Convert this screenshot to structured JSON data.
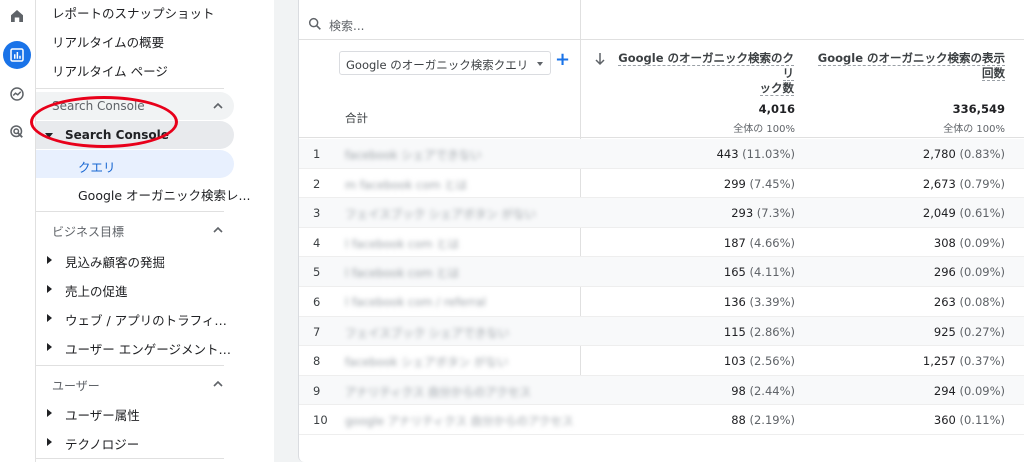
{
  "nav": {
    "items_top": [
      "レポートのスナップショット",
      "リアルタイムの概要",
      "リアルタイム ページ"
    ],
    "search_console_section": "Search Console",
    "search_console_subgroup": "Search Console",
    "search_console_children": [
      "クエリ",
      "Google オーガニック検索レ..."
    ],
    "business_section": "ビジネス目標",
    "business_items": [
      "見込み顧客の発掘",
      "売上の促進",
      "ウェブ / アプリのトラフィック...",
      "ユーザー エンゲージメントと..."
    ],
    "user_section": "ユーザー",
    "user_items": [
      "ユーザー属性",
      "テクノロジー"
    ]
  },
  "table": {
    "search_placeholder": "検索...",
    "dimension_select": "Google のオーガニック検索クエリ",
    "add_icon": "+",
    "col1_header_line1": "Google のオーガニック検索のクリ",
    "col1_header_line2": "ック数",
    "col2_header_line1": "Google のオーガニック検索の表示",
    "col2_header_line2": "回数",
    "total_label": "合計",
    "total_clicks": "4,016",
    "total_clicks_pct": "全体の 100%",
    "total_impressions": "336,549",
    "total_impressions_pct": "全体の 100%",
    "rows": [
      {
        "idx": "1",
        "query": "facebook シェアできない",
        "clicks": "443",
        "clicks_pct": "(11.03%)",
        "impr": "2,780",
        "impr_pct": "(0.83%)"
      },
      {
        "idx": "2",
        "query": "m facebook com とは",
        "clicks": "299",
        "clicks_pct": "(7.45%)",
        "impr": "2,673",
        "impr_pct": "(0.79%)"
      },
      {
        "idx": "3",
        "query": "フェイスブック シェアボタン がない",
        "clicks": "293",
        "clicks_pct": "(7.3%)",
        "impr": "2,049",
        "impr_pct": "(0.61%)"
      },
      {
        "idx": "4",
        "query": "l facebook com とは",
        "clicks": "187",
        "clicks_pct": "(4.66%)",
        "impr": "308",
        "impr_pct": "(0.09%)"
      },
      {
        "idx": "5",
        "query": "l facebook com とは",
        "clicks": "165",
        "clicks_pct": "(4.11%)",
        "impr": "296",
        "impr_pct": "(0.09%)"
      },
      {
        "idx": "6",
        "query": "l facebook com / referral",
        "clicks": "136",
        "clicks_pct": "(3.39%)",
        "impr": "263",
        "impr_pct": "(0.08%)"
      },
      {
        "idx": "7",
        "query": "フェイスブック シェアできない",
        "clicks": "115",
        "clicks_pct": "(2.86%)",
        "impr": "925",
        "impr_pct": "(0.27%)"
      },
      {
        "idx": "8",
        "query": "facebook シェアボタン がない",
        "clicks": "103",
        "clicks_pct": "(2.56%)",
        "impr": "1,257",
        "impr_pct": "(0.37%)"
      },
      {
        "idx": "9",
        "query": "アナリティクス 自分からのアクセス",
        "clicks": "98",
        "clicks_pct": "(2.44%)",
        "impr": "294",
        "impr_pct": "(0.09%)"
      },
      {
        "idx": "10",
        "query": "google アナリティクス 自分からのアクセス",
        "clicks": "88",
        "clicks_pct": "(2.19%)",
        "impr": "360",
        "impr_pct": "(0.11%)"
      }
    ]
  },
  "colors": {
    "accent": "#1a73e8",
    "annotation": "#e8001a"
  },
  "icons": [
    "home-icon",
    "reports-icon",
    "explore-icon",
    "advertising-icon",
    "search-icon",
    "sort-down-arrow-icon"
  ]
}
